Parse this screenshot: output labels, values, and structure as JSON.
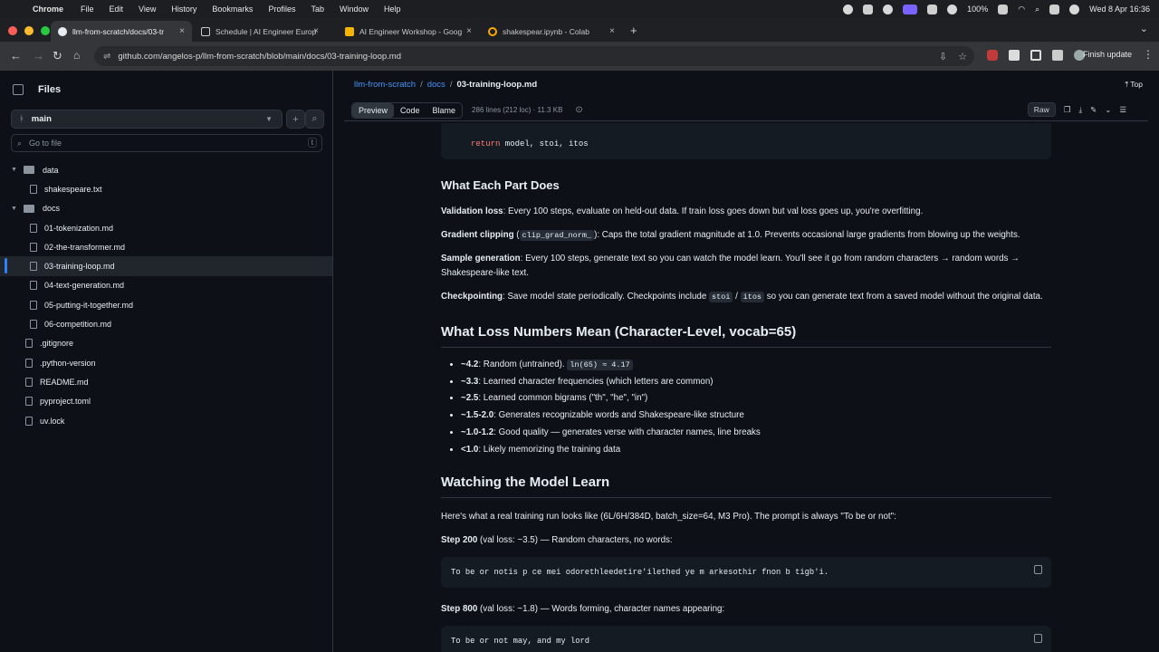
{
  "menubar": {
    "app": "Chrome",
    "items": [
      "File",
      "Edit",
      "View",
      "History",
      "Bookmarks",
      "Profiles",
      "Tab",
      "Window",
      "Help"
    ],
    "battery": "100%",
    "clock": "Wed 8 Apr  16:36"
  },
  "tabs": [
    {
      "label": "llm-from-scratch/docs/03-tr",
      "active": true
    },
    {
      "label": "Schedule | AI Engineer Europ",
      "active": false
    },
    {
      "label": "AI Engineer Workshop - Goog",
      "active": false
    },
    {
      "label": "shakespear.ipynb - Colab",
      "active": false
    }
  ],
  "address": {
    "url": "github.com/angelos-p/llm-from-scratch/blob/main/docs/03-training-loop.md",
    "finish_update": "Finish update"
  },
  "sidebar": {
    "title": "Files",
    "branch": "main",
    "goto_placeholder": "Go to file",
    "goto_key": "t",
    "tree": [
      {
        "label": "data",
        "type": "folder",
        "depth": 0,
        "open": true
      },
      {
        "label": "shakespeare.txt",
        "type": "file",
        "depth": 1
      },
      {
        "label": "docs",
        "type": "folder",
        "depth": 0,
        "open": true
      },
      {
        "label": "01-tokenization.md",
        "type": "file",
        "depth": 1
      },
      {
        "label": "02-the-transformer.md",
        "type": "file",
        "depth": 1
      },
      {
        "label": "03-training-loop.md",
        "type": "file",
        "depth": 1,
        "selected": true
      },
      {
        "label": "04-text-generation.md",
        "type": "file",
        "depth": 1
      },
      {
        "label": "05-putting-it-together.md",
        "type": "file",
        "depth": 1
      },
      {
        "label": "06-competition.md",
        "type": "file",
        "depth": 1
      },
      {
        "label": ".gitignore",
        "type": "file",
        "depth": 0
      },
      {
        "label": ".python-version",
        "type": "file",
        "depth": 0
      },
      {
        "label": "README.md",
        "type": "file",
        "depth": 0
      },
      {
        "label": "pyproject.toml",
        "type": "file",
        "depth": 0
      },
      {
        "label": "uv.lock",
        "type": "file",
        "depth": 0
      }
    ]
  },
  "breadcrumb": {
    "repo": "llm-from-scratch",
    "folder": "docs",
    "file": "03-training-loop.md",
    "top": "Top"
  },
  "filebar": {
    "tabs": [
      "Preview",
      "Code",
      "Blame"
    ],
    "info": "286 lines (212 loc) · 11.3 KB",
    "raw": "Raw"
  },
  "doc": {
    "code_return_kw": "return",
    "code_return_rest": " model, stoi, itos",
    "h_parts": "What Each Part Does",
    "p1_b": "Validation loss",
    "p1": ": Every 100 steps, evaluate on held-out data. If train loss goes down but val loss goes up, you're overfitting.",
    "p2_b": "Gradient clipping",
    "p2_pre": " (",
    "p2_code": "clip_grad_norm_",
    "p2": "): Caps the total gradient magnitude at 1.0. Prevents occasional large gradients from blowing up the weights.",
    "p3_b": "Sample generation",
    "p3": ": Every 100 steps, generate text so you can watch the model learn. You'll see it go from random characters → random words → Shakespeare-like text.",
    "p4_b": "Checkpointing",
    "p4_pre": ": Save model state periodically. Checkpoints include ",
    "p4_code1": "stoi",
    "p4_slash": " / ",
    "p4_code2": "itos",
    "p4": " so you can generate text from a saved model without the original data.",
    "h_loss": "What Loss Numbers Mean (Character-Level, vocab=65)",
    "loss_items": [
      {
        "b": "~4.2",
        "t": ": Random (untrained). ",
        "code": "ln(65) ≈ 4.17"
      },
      {
        "b": "~3.3",
        "t": ": Learned character frequencies (which letters are common)",
        "code": ""
      },
      {
        "b": "~2.5",
        "t": ": Learned common bigrams (\"th\", \"he\", \"in\")",
        "code": ""
      },
      {
        "b": "~1.5-2.0",
        "t": ": Generates recognizable words and Shakespeare-like structure",
        "code": ""
      },
      {
        "b": "~1.0-1.2",
        "t": ": Good quality — generates verse with character names, line breaks",
        "code": ""
      },
      {
        "b": "<1.0",
        "t": ": Likely memorizing the training data",
        "code": ""
      }
    ],
    "h_watch": "Watching the Model Learn",
    "p5": "Here's what a real training run looks like (6L/6H/384D, batch_size=64, M3 Pro). The prompt is always \"To be or not\":",
    "s200_b": "Step 200",
    "s200": " (val loss: ~3.5) — Random characters, no words:",
    "s200_code": "To be or notis p ce mei odorethleedetire'ilethed ye m arkesothir fnon b tigb'i.",
    "s800_b": "Step 800",
    "s800": " (val loss: ~1.8) — Words forming, character names appearing:",
    "s800_code": "To be or not may, and my lord"
  }
}
